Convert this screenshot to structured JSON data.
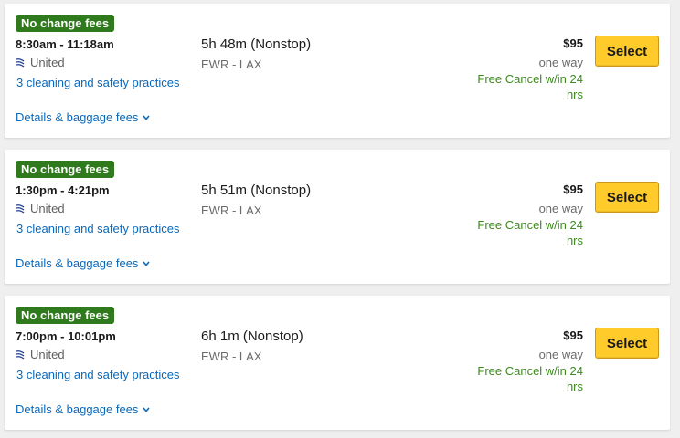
{
  "colors": {
    "badge_green": "#2f7a1c",
    "link_blue": "#0a68b9",
    "cancel_green": "#3c8a1e",
    "select_yellow": "#ffcb2b",
    "page_bg": "#efefef"
  },
  "flights": [
    {
      "badge": "No change fees",
      "times": "8:30am - 11:18am",
      "airline_icon": "united-logo-icon",
      "airline": "United",
      "safety": "3 cleaning and safety practices",
      "details": "Details & baggage fees",
      "duration": "5h 48m (Nonstop)",
      "route": "EWR - LAX",
      "price": "$95",
      "trip_type": "one way",
      "cancel": "Free Cancel w/in 24 hrs",
      "select_label": "Select"
    },
    {
      "badge": "No change fees",
      "times": "1:30pm - 4:21pm",
      "airline_icon": "united-logo-icon",
      "airline": "United",
      "safety": "3 cleaning and safety practices",
      "details": "Details & baggage fees",
      "duration": "5h 51m (Nonstop)",
      "route": "EWR - LAX",
      "price": "$95",
      "trip_type": "one way",
      "cancel": "Free Cancel w/in 24 hrs",
      "select_label": "Select"
    },
    {
      "badge": "No change fees",
      "times": "7:00pm - 10:01pm",
      "airline_icon": "united-logo-icon",
      "airline": "United",
      "safety": "3 cleaning and safety practices",
      "details": "Details & baggage fees",
      "duration": "6h 1m (Nonstop)",
      "route": "EWR - LAX",
      "price": "$95",
      "trip_type": "one way",
      "cancel": "Free Cancel w/in 24 hrs",
      "select_label": "Select"
    }
  ]
}
